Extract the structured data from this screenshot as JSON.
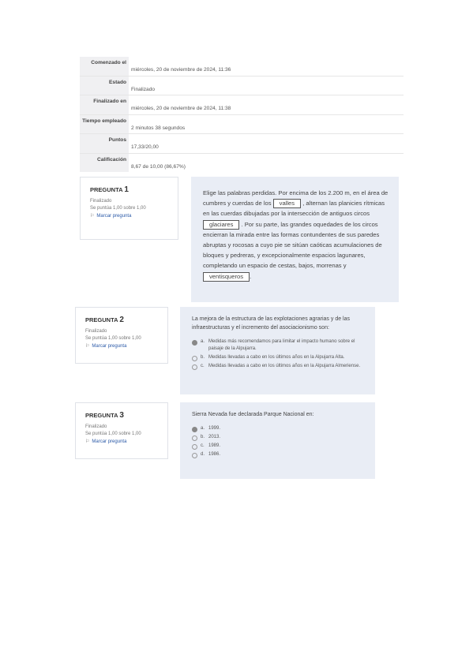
{
  "summary": {
    "rows": [
      {
        "label": "Comenzado el",
        "value": "miércoles, 20 de noviembre de 2024, 11:36"
      },
      {
        "label": "Estado",
        "value": "Finalizado"
      },
      {
        "label": "Finalizado en",
        "value": "miércoles, 20 de noviembre de 2024, 11:38"
      },
      {
        "label": "Tiempo empleado",
        "value": "2 minutos 38 segundos"
      },
      {
        "label": "Puntos",
        "value": "17,33/20,00"
      },
      {
        "label": "Calificación",
        "value": "8,67 de 10,00 (86,67%)"
      }
    ]
  },
  "questions": [
    {
      "title": "PREGUNTA",
      "number": "1",
      "state": "Finalizado",
      "score": "Se puntúa 1,00 sobre 1,00",
      "flag": "Marcar pregunta",
      "q1": {
        "t1": "Elige las palabras perdidas. Por encima de los 2.200 m, en el área de cumbres y cuerdas de los",
        "gap1": "valles",
        "t2": ", alternan las planicies rítmicas en las cuerdas dibujadas por la intersección de antiguos circos",
        "gap2": "glaciares",
        "t3": ". Por su parte, las grandes oquedades de los circos encierran la mirada entre las formas contundentes de sus paredes abruptas y rocosas a cuyo pie se sitúan caóticas acumulaciones de bloques y pedreras, y excepcionalmente espacios lagunares, completando un espacio de cestas, bajos, morrenas y",
        "gap3": "ventisqueros",
        "t4": "."
      }
    },
    {
      "title": "PREGUNTA",
      "number": "2",
      "state": "Finalizado",
      "score": "Se puntúa 1,00 sobre 1,00",
      "flag": "Marcar pregunta",
      "text": "La mejora de la estructura de las explotaciones agrarias y de las infraestructuras y el incremento del asociacionismo son:",
      "options": [
        {
          "letter": "a.",
          "text": "Medidas más recomendamos para limitar el impacto humano sobre el paisaje de la Alpujarra.",
          "selected": true
        },
        {
          "letter": "b.",
          "text": "Medidas llevadas a cabo en los últimos años en la Alpujarra Alta.",
          "selected": false
        },
        {
          "letter": "c.",
          "text": "Medidas llevadas a cabo en los últimos años en la Alpujarra Almeriense.",
          "selected": false
        }
      ]
    },
    {
      "title": "PREGUNTA",
      "number": "3",
      "state": "Finalizado",
      "score": "Se puntúa 1,00 sobre 1,00",
      "flag": "Marcar pregunta",
      "text": "Sierra Nevada fue declarada Parque Nacional en:",
      "options": [
        {
          "letter": "a.",
          "text": "1999.",
          "selected": true
        },
        {
          "letter": "b.",
          "text": "2013.",
          "selected": false
        },
        {
          "letter": "c.",
          "text": "1989.",
          "selected": false
        },
        {
          "letter": "d.",
          "text": "1986.",
          "selected": false
        }
      ]
    }
  ]
}
